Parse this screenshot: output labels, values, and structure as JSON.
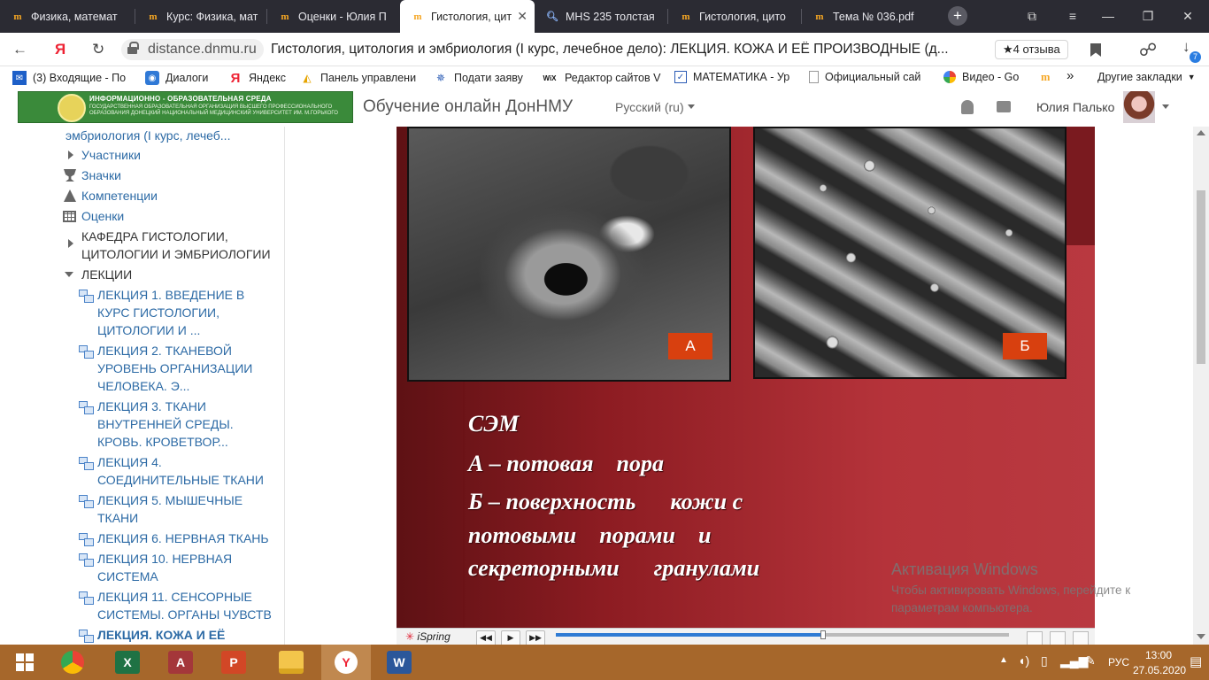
{
  "browser": {
    "tabs": [
      {
        "title": "Физика, математ",
        "icon": "moodle-icon"
      },
      {
        "title": "Курс: Физика, мат",
        "icon": "moodle-icon"
      },
      {
        "title": "Оценки - Юлия П",
        "icon": "moodle-icon"
      },
      {
        "title": "Гистология, цит",
        "icon": "moodle-icon",
        "active": true
      },
      {
        "title": "MHS 235 толстая",
        "icon": "search-icon"
      },
      {
        "title": "Гистология, цито",
        "icon": "moodle-icon"
      },
      {
        "title": "Тема № 036.pdf",
        "icon": "moodle-icon"
      }
    ],
    "download_count": "7",
    "address": {
      "domain": "distance.dnmu.ru",
      "title": "Гистология, цитология и эмбриология (I курс, лечебное дело): ЛЕКЦИЯ. КОЖА И ЕЁ ПРОИЗВОДНЫЕ (д...",
      "reviews": "★4 отзыва"
    },
    "bookmarks": [
      {
        "label": "(3) Входящие - По",
        "icon": "mail-icon"
      },
      {
        "label": "Диалоги",
        "icon": "chat-icon"
      },
      {
        "label": "Яндекс",
        "icon": "yandex-icon"
      },
      {
        "label": "Панель управлени",
        "icon": "panel-icon"
      },
      {
        "label": "Подати заяву",
        "icon": "emblem-icon"
      },
      {
        "label": "Редактор сайтов V",
        "icon": "wix-icon"
      },
      {
        "label": "МАТЕМАТИКА - Ур",
        "icon": "checkbox-icon"
      },
      {
        "label": "Официальный сай",
        "icon": "page-icon"
      },
      {
        "label": "Видео - Go",
        "icon": "photos-icon"
      }
    ],
    "other_bookmarks": "Другие закладки"
  },
  "site": {
    "logo": {
      "line1": "ИНФОРМАЦИОННО - ОБРАЗОВАТЕЛЬНАЯ СРЕДА",
      "line2": "ГОСУДАРСТВЕННАЯ ОБРАЗОВАТЕЛЬНАЯ ОРГАНИЗАЦИЯ ВЫСШЕГО ПРОФЕССИОНАЛЬНОГО ОБРАЗОВАНИЯ ДОНЕЦКИЙ НАЦИОНАЛЬНЫЙ МЕДИЦИНСКИЙ УНИВЕРСИТЕТ ИМ. М.ГОРЬКОГО"
    },
    "name": "Обучение онлайн ДонНМУ",
    "language": "Русский (ru)",
    "user_name": "Юлия Палько"
  },
  "sidebar": {
    "course_tail": "эмбриология (I курс, лечеб...",
    "participants": "Участники",
    "badges": "Значки",
    "competencies": "Компетенции",
    "grades": "Оценки",
    "department": "КАФЕДРА ГИСТОЛОГИИ, ЦИТОЛОГИИ И ЭМБРИОЛОГИИ",
    "lectures": "ЛЕКЦИИ",
    "lecture_items": [
      "ЛЕКЦИЯ 1. ВВЕДЕНИЕ В КУРС ГИСТОЛОГИИ, ЦИТОЛОГИИ И ...",
      "ЛЕКЦИЯ 2. ТКАНЕВОЙ УРОВЕНЬ ОРГАНИЗАЦИИ ЧЕЛОВЕКА. Э...",
      "ЛЕКЦИЯ 3. ТКАНИ ВНУТРЕННЕЙ СРЕДЫ. КРОВЬ. КРОВЕТВОР...",
      "ЛЕКЦИЯ 4. СОЕДИНИТЕЛЬНЫЕ ТКАНИ",
      "ЛЕКЦИЯ 5. МЫШЕЧНЫЕ ТКАНИ",
      "ЛЕКЦИЯ 6. НЕРВНАЯ ТКАНЬ",
      "ЛЕКЦИЯ 10. НЕРВНАЯ СИСТЕМА",
      "ЛЕКЦИЯ 11. СЕНСОРНЫЕ СИСТЕМЫ. ОРГАНЫ ЧУВСТВ",
      "ЛЕКЦИЯ. КОЖА И ЕЁ"
    ]
  },
  "slide": {
    "label_a": "А",
    "label_b": "Б",
    "caption": [
      "СЭМ",
      "А – потовая    пора",
      "Б – поверхность      кожи с",
      "потовыми    порами    и",
      "секреторными      гранулами"
    ]
  },
  "player": {
    "brand": "iSpring",
    "progress_percent": 59
  },
  "watermark": {
    "title": "Активация Windows",
    "text": "Чтобы активировать Windows, перейдите к параметрам компьютера."
  },
  "taskbar": {
    "apps": [
      "chrome-icon",
      "excel-icon",
      "access-icon",
      "powerpoint-icon",
      "explorer-icon",
      "yandex-browser-icon",
      "word-icon"
    ],
    "language": "РУС",
    "time": "13:00",
    "date": "27.05.2020"
  }
}
